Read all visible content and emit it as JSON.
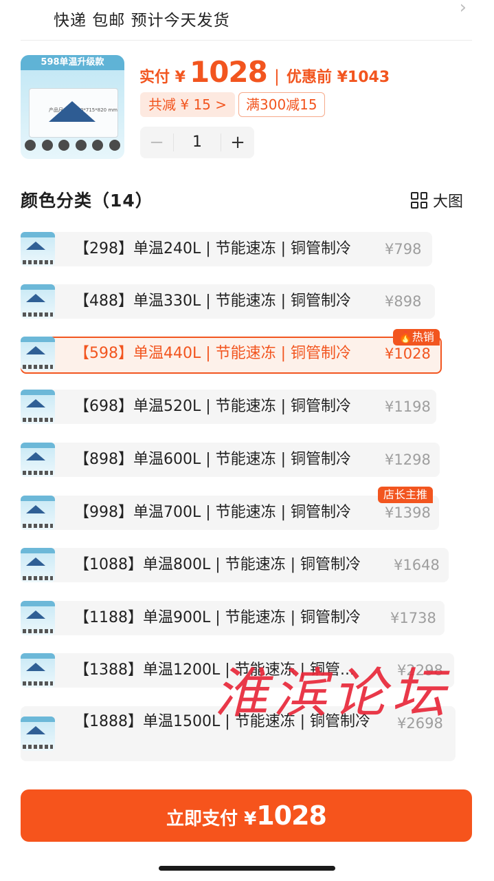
{
  "shipping": {
    "text": "快递 包邮 预计今天发货"
  },
  "product": {
    "thumb_title": "598单温升级款",
    "thumb_spec": "产品尺寸: 1420*715*820 mm",
    "pay_label": "实付 ¥",
    "pay_amount": "1028",
    "before_label": "优惠前 ¥1043",
    "discount_chip": "共减 ¥ 15 >",
    "coupon_chip": "满300减15",
    "quantity": "1",
    "minus": "−",
    "plus": "+"
  },
  "section": {
    "title": "颜色分类（14）",
    "big_view": "大图"
  },
  "options": [
    {
      "label": "【298】单温240L | 节能速冻 | 铜管制冷",
      "price": "¥798"
    },
    {
      "label": "【488】单温330L | 节能速冻 | 铜管制冷",
      "price": "¥898"
    },
    {
      "label": "【598】单温440L | 节能速冻 | 铜管制冷",
      "price": "¥1028",
      "badge": "热销"
    },
    {
      "label": "【698】单温520L | 节能速冻 | 铜管制冷",
      "price": "¥1198"
    },
    {
      "label": "【898】单温600L | 节能速冻 | 铜管制冷",
      "price": "¥1298"
    },
    {
      "label": "【998】单温700L | 节能速冻 | 铜管制冷",
      "price": "¥1398",
      "badge": "店长主推"
    },
    {
      "label": "【1088】单温800L | 节能速冻 | 铜管制冷",
      "price": "¥1648"
    },
    {
      "label": "【1188】单温900L | 节能速冻 | 铜管制冷",
      "price": "¥1738"
    },
    {
      "label": "【1388】单温1200L | 节能速冻 | 铜管...",
      "price": "¥2298"
    },
    {
      "label": "【1888】单温1500L | 节能速冻 | 铜管制冷",
      "price": "¥2698"
    }
  ],
  "selected_index": 2,
  "watermark": "淮滨论坛",
  "pay_button": {
    "label": "立即支付 ¥",
    "amount": "1028"
  },
  "colors": {
    "accent": "#f2551f",
    "selected_bg": "#fdf1ea",
    "option_bg": "#f5f5f5"
  }
}
